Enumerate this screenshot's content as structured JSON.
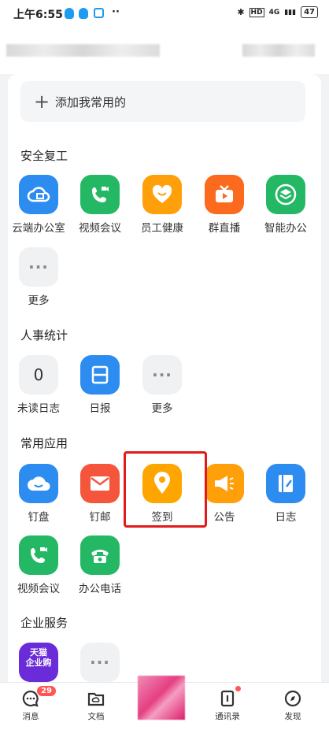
{
  "status": {
    "time": "上午6:55",
    "dots": "··",
    "bt": "✱",
    "hd": "HD",
    "net": "4G",
    "signal": "▮▮▮",
    "battery": "47"
  },
  "add_label": "添加我常用的",
  "sections": {
    "s1": {
      "title": "安全复工",
      "apps": [
        "云端办公室",
        "视频会议",
        "员工健康",
        "群直播",
        "智能办公",
        "更多"
      ]
    },
    "s2": {
      "title": "人事统计",
      "apps": [
        "未读日志",
        "日报",
        "更多"
      ],
      "count": "0"
    },
    "s3": {
      "title": "常用应用",
      "apps": [
        "钉盘",
        "钉邮",
        "签到",
        "公告",
        "日志",
        "视频会议",
        "办公电话"
      ]
    },
    "s4": {
      "title": "企业服务",
      "tmall_line1": "天猫",
      "tmall_line2": "企业购"
    }
  },
  "tabs": {
    "messages": "消息",
    "docs": "文档",
    "contacts": "通讯录",
    "discover": "发现",
    "badge": "29"
  },
  "more_glyph": "···",
  "colors": {
    "blue": "#2d8cf0",
    "green": "#25b864",
    "orange": "#ff9f0a",
    "red": "#f4553b",
    "highlight": "#e21a1a"
  }
}
